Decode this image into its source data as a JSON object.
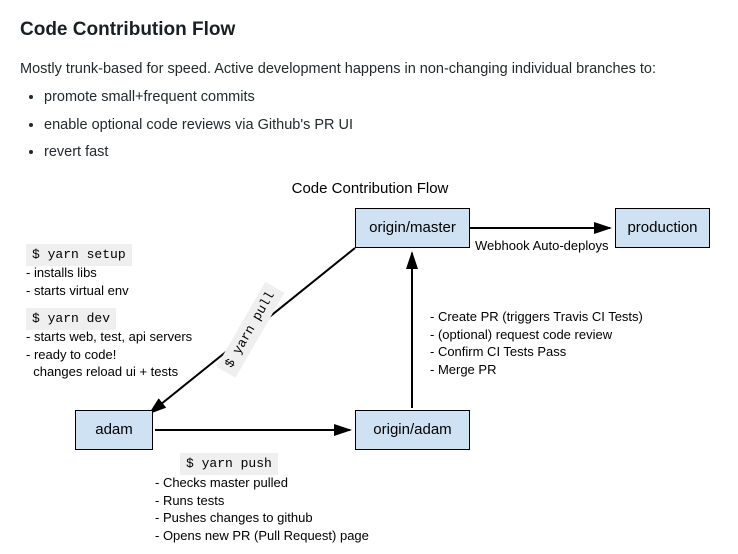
{
  "heading": "Code Contribution Flow",
  "intro": "Mostly trunk-based for speed. Active development happens in non-changing individual branches to:",
  "bullets": [
    "promote small+frequent commits",
    "enable optional code reviews via Github's PR UI",
    "revert fast"
  ],
  "diagram": {
    "title": "Code Contribution Flow",
    "nodes": {
      "adam": "adam",
      "origin_master": "origin/master",
      "origin_adam": "origin/adam",
      "production": "production"
    },
    "commands": {
      "yarn_setup": "$ yarn setup",
      "yarn_dev": "$ yarn dev",
      "yarn_pull": "$ yarn pull",
      "yarn_push": "$ yarn push"
    },
    "notes": {
      "setup": "- installs libs\n- starts virtual env",
      "dev": "- starts web, test, api servers\n- ready to code!\n  changes reload ui + tests",
      "push": "- Checks master pulled\n- Runs tests\n- Pushes changes to github\n- Opens new PR (Pull Request) page",
      "pr": "- Create PR (triggers Travis CI Tests)\n- (optional) request code review\n- Confirm CI Tests Pass\n- Merge PR"
    },
    "edge_labels": {
      "deploy": "Webhook Auto-deploys"
    }
  }
}
